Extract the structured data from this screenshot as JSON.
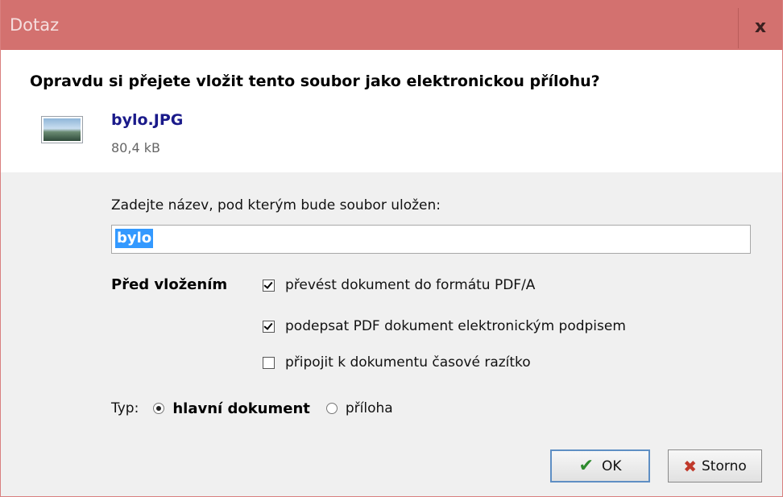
{
  "window": {
    "title": "Dotaz",
    "close_label": "x"
  },
  "question": "Opravdu si přejete vložit tento soubor jako elektronickou přílohu?",
  "file": {
    "name": "bylo.JPG",
    "size": "80,4 kB",
    "icon": "image-file-icon"
  },
  "name_field": {
    "label": "Zadejte název, pod kterým bude soubor uložen:",
    "value": "bylo"
  },
  "before_insert": {
    "label": "Před vložením",
    "options": [
      {
        "label": "převést dokument do formátu PDF/A",
        "checked": true
      },
      {
        "label": "podepsat PDF dokument elektronickým podpisem",
        "checked": true
      },
      {
        "label": "připojit k dokumentu časové razítko",
        "checked": false
      }
    ]
  },
  "type": {
    "label": "Typ:",
    "options": [
      {
        "label": "hlavní dokument",
        "selected": true
      },
      {
        "label": "příloha",
        "selected": false
      }
    ]
  },
  "buttons": {
    "ok_label": "OK",
    "cancel_label": "Storno"
  },
  "colors": {
    "titlebar": "#d3716f",
    "accent": "#3399ff"
  }
}
